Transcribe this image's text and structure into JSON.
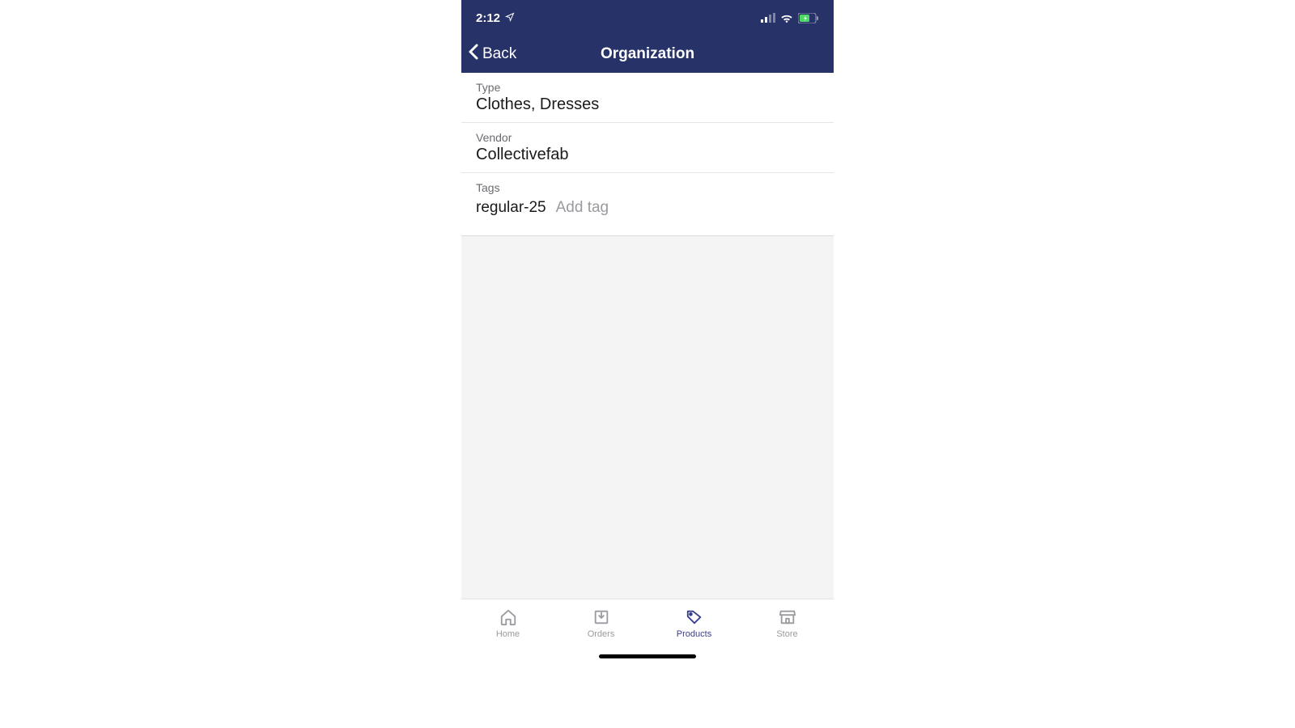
{
  "statusBar": {
    "time": "2:12"
  },
  "nav": {
    "backLabel": "Back",
    "title": "Organization"
  },
  "fields": {
    "type": {
      "label": "Type",
      "value": "Clothes, Dresses"
    },
    "vendor": {
      "label": "Vendor",
      "value": "Collectivefab"
    },
    "tags": {
      "label": "Tags",
      "items": [
        "regular-25"
      ],
      "addPlaceholder": "Add tag"
    }
  },
  "tabs": {
    "home": "Home",
    "orders": "Orders",
    "products": "Products",
    "store": "Store"
  }
}
